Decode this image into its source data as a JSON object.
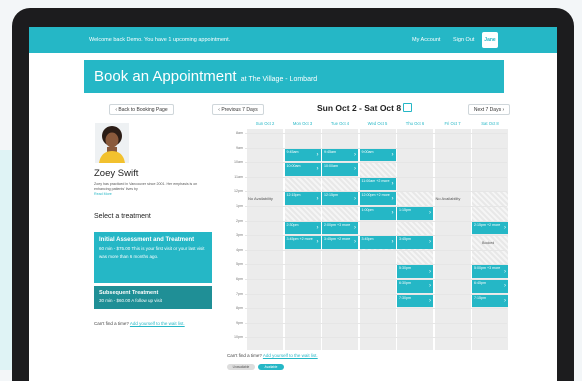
{
  "topbar": {
    "welcome": "Welcome back Demo. You have 1 upcoming appointment.",
    "my_account": "My Account",
    "sign_out": "Sign Out",
    "logo_text": "Jane"
  },
  "header": {
    "title": "Book an Appointment",
    "location": "at The Village - Lombard"
  },
  "nav": {
    "back": "‹ Back to Booking Page",
    "prev": "‹ Previous 7 Days",
    "next": "Next 7 Days ›",
    "range": "Sun Oct 2 - Sat Oct 8"
  },
  "practitioner": {
    "name": "Zoey Swift",
    "bio": "Zoey has practiced in Vancouver since 2001. Her emphasis is on enhancing patients' lives by",
    "read_more": "Read More"
  },
  "treatments": {
    "heading": "Select a treatment",
    "items": [
      {
        "name": "Initial Assessment and Treatment",
        "desc": "60 min - $75.00 This is your first visit or your last visit was more than 6 months ago."
      },
      {
        "name": "Subsequent Treatment",
        "desc": "30 min - $60.00 A follow up visit"
      }
    ]
  },
  "waitlist": {
    "text": "Can't find a time?",
    "link": "Add yourself to the wait list."
  },
  "calendar": {
    "days": [
      "Sun Oct 2",
      "Mon Oct 3",
      "Tue Oct 4",
      "Wed Oct 5",
      "Thu Oct 6",
      "Fri Oct 7",
      "Sat Oct 8"
    ],
    "hours": [
      "8am",
      "9am",
      "10am",
      "11am",
      "12pm",
      "1pm",
      "2pm",
      "3pm",
      "4pm",
      "5pm",
      "6pm",
      "7pm",
      "8pm",
      "9pm",
      "10pm"
    ],
    "no_availability": "No Availability",
    "booked": "Booked",
    "slots": [
      {
        "day": 1,
        "hour": 9,
        "label": "9:45am"
      },
      {
        "day": 1,
        "hour": 10,
        "label": "10:00am"
      },
      {
        "day": 1,
        "hour": 12,
        "label": "12:15pm"
      },
      {
        "day": 1,
        "hour": 14,
        "label": "2:30pm"
      },
      {
        "day": 1,
        "hour": 15,
        "label": "3:45pm +2 more"
      },
      {
        "day": 2,
        "hour": 9,
        "label": "9:45am"
      },
      {
        "day": 2,
        "hour": 10,
        "label": "10:00am"
      },
      {
        "day": 2,
        "hour": 12,
        "label": "12:15pm"
      },
      {
        "day": 2,
        "hour": 14,
        "label": "2:00pm +3 more"
      },
      {
        "day": 2,
        "hour": 15,
        "label": "3:45pm +2 more"
      },
      {
        "day": 3,
        "hour": 9,
        "label": "9:00am"
      },
      {
        "day": 3,
        "hour": 11,
        "label": "11:00am +2 more"
      },
      {
        "day": 3,
        "hour": 12,
        "label": "12:00pm +2 more"
      },
      {
        "day": 3,
        "hour": 13,
        "label": "1:00pm"
      },
      {
        "day": 3,
        "hour": 15,
        "label": "3:45pm"
      },
      {
        "day": 4,
        "hour": 13,
        "label": "1:15pm"
      },
      {
        "day": 4,
        "hour": 15,
        "label": "3:45pm"
      },
      {
        "day": 4,
        "hour": 17,
        "label": "5:30pm"
      },
      {
        "day": 4,
        "hour": 18,
        "label": "6:30pm"
      },
      {
        "day": 4,
        "hour": 19,
        "label": "7:30pm"
      },
      {
        "day": 6,
        "hour": 14,
        "label": "2:15pm +2 more"
      },
      {
        "day": 6,
        "hour": 17,
        "label": "5:00pm +3 more"
      },
      {
        "day": 6,
        "hour": 18,
        "label": "6:45pm"
      },
      {
        "day": 6,
        "hour": 19,
        "label": "7:15pm"
      }
    ]
  },
  "legend": {
    "unavailable": "Unavailable",
    "available": "Available"
  },
  "colors": {
    "accent": "#25b7c6",
    "accent_dark": "#1f8f96"
  }
}
